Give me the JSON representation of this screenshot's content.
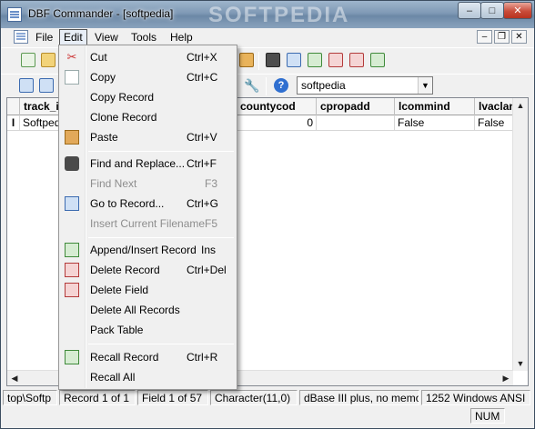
{
  "window": {
    "title": "DBF Commander - [softpedia]",
    "watermark": "SOFTPEDIA",
    "caption_buttons": {
      "minimize": "–",
      "maximize": "□",
      "close": "✕"
    }
  },
  "menubar": {
    "items": [
      {
        "label": "File"
      },
      {
        "label": "Edit"
      },
      {
        "label": "View"
      },
      {
        "label": "Tools"
      },
      {
        "label": "Help"
      }
    ],
    "mdi_buttons": {
      "minimize": "–",
      "restore": "❐",
      "close": "✕"
    }
  },
  "toolbar": {
    "table_combo_value": "softpedia"
  },
  "grid": {
    "columns": [
      "track_i",
      "countycod",
      "cpropadd",
      "lcommind",
      "lvaclan"
    ],
    "row": {
      "indicator": "I",
      "cells": [
        "Softpedia",
        "0",
        "",
        "False",
        "False"
      ]
    }
  },
  "statusbar": {
    "panels": [
      "top\\Softp",
      "Record 1 of 1",
      "Field 1 of 57",
      "Character(11,0)",
      "dBase III plus, no memo",
      "1252 Windows ANSI"
    ],
    "num_indicator": "NUM"
  },
  "edit_menu": {
    "items": [
      {
        "label": "Cut",
        "shortcut": "Ctrl+X",
        "icon": "scissors-icon",
        "disabled": false
      },
      {
        "label": "Copy",
        "shortcut": "Ctrl+C",
        "icon": "copy-icon",
        "disabled": false
      },
      {
        "label": "Copy Record",
        "shortcut": "",
        "icon": "",
        "disabled": false
      },
      {
        "label": "Clone Record",
        "shortcut": "",
        "icon": "",
        "disabled": false
      },
      {
        "label": "Paste",
        "shortcut": "Ctrl+V",
        "icon": "clipboard-icon",
        "disabled": false
      },
      {
        "label": "Find and Replace...",
        "shortcut": "Ctrl+F",
        "icon": "binoculars-icon",
        "disabled": false
      },
      {
        "label": "Find Next",
        "shortcut": "F3",
        "icon": "",
        "disabled": true
      },
      {
        "label": "Go to Record...",
        "shortcut": "Ctrl+G",
        "icon": "goto-record-icon",
        "disabled": false
      },
      {
        "label": "Insert Current Filename",
        "shortcut": "F5",
        "icon": "",
        "disabled": true
      },
      {
        "label": "Append/Insert Record",
        "shortcut": "Ins",
        "icon": "append-record-icon",
        "disabled": false
      },
      {
        "label": "Delete Record",
        "shortcut": "Ctrl+Del",
        "icon": "delete-record-icon",
        "disabled": false
      },
      {
        "label": "Delete Field",
        "shortcut": "",
        "icon": "delete-field-icon",
        "disabled": false
      },
      {
        "label": "Delete All Records",
        "shortcut": "",
        "icon": "",
        "disabled": false
      },
      {
        "label": "Pack Table",
        "shortcut": "",
        "icon": "",
        "disabled": false
      },
      {
        "label": "Recall Record",
        "shortcut": "Ctrl+R",
        "icon": "recall-record-icon",
        "disabled": false
      },
      {
        "label": "Recall All",
        "shortcut": "",
        "icon": "",
        "disabled": false
      }
    ]
  },
  "colors": {
    "menu_bg": "#f0f0f0",
    "disabled_text": "#8d8d8d",
    "titlebar": "#7f99b5",
    "close_button": "#c94c3a"
  }
}
